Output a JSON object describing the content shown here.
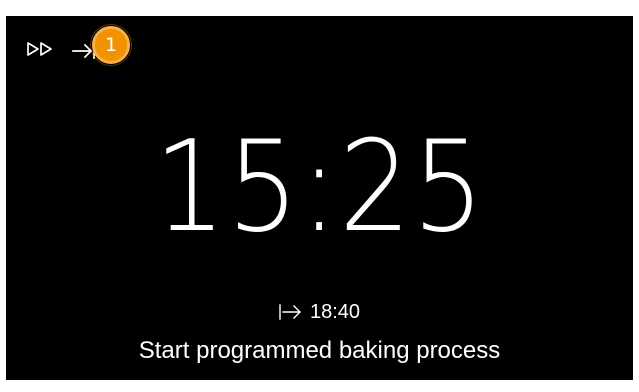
{
  "toolbar": {
    "fast_forward_icon": "fast-forward-icon",
    "skip_icon": "skip-to-end-icon",
    "callout_number": "1"
  },
  "main": {
    "clock": "15:25",
    "end_time_icon": "end-time-arrow-icon",
    "end_time": "18:40",
    "status": "Start programmed baking process"
  },
  "colors": {
    "background": "#000000",
    "text": "#ffffff",
    "callout": "#f39200"
  }
}
